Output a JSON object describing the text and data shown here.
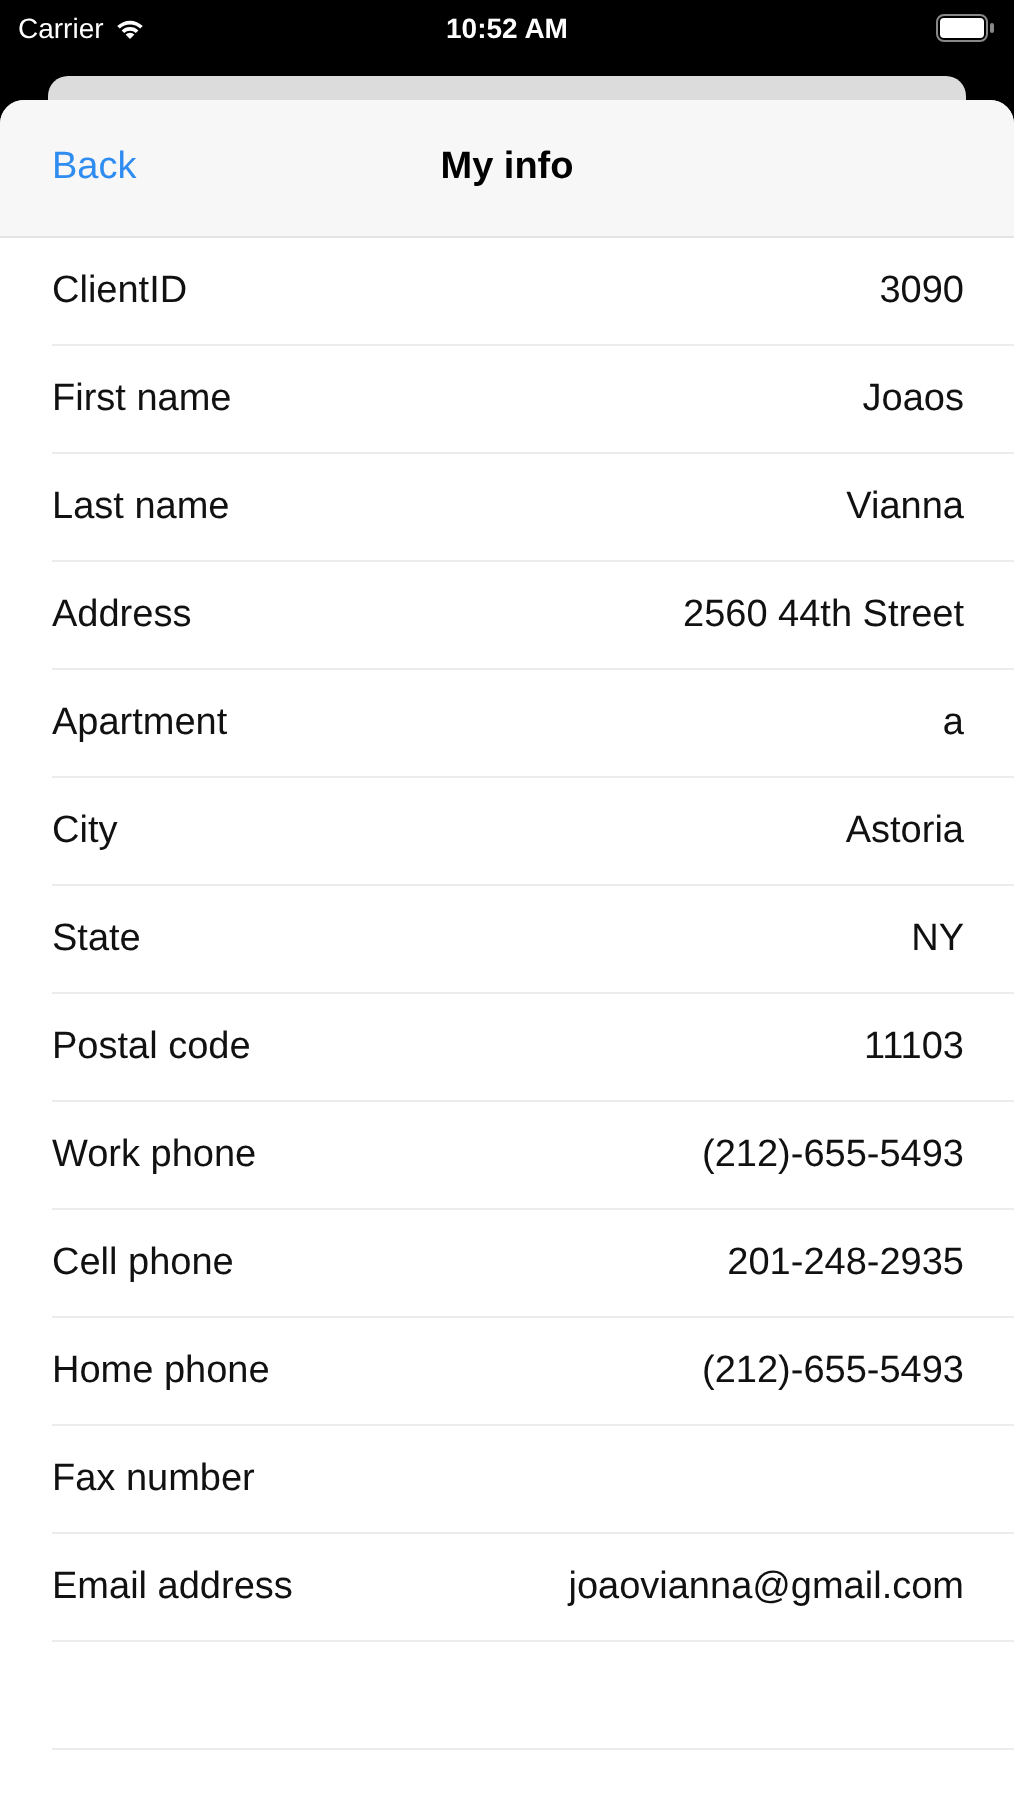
{
  "status_bar": {
    "carrier": "Carrier",
    "time": "10:52 AM"
  },
  "nav_bar": {
    "back": "Back",
    "title": "My info"
  },
  "fields": [
    {
      "label": "ClientID",
      "value": "3090"
    },
    {
      "label": "First name",
      "value": "Joaos"
    },
    {
      "label": "Last name",
      "value": "Vianna"
    },
    {
      "label": "Address",
      "value": "2560 44th Street"
    },
    {
      "label": "Apartment",
      "value": "a"
    },
    {
      "label": "City",
      "value": "Astoria"
    },
    {
      "label": "State",
      "value": "NY"
    },
    {
      "label": "Postal code",
      "value": "11103"
    },
    {
      "label": "Work phone",
      "value": "(212)-655-5493"
    },
    {
      "label": "Cell phone",
      "value": "201-248-2935"
    },
    {
      "label": "Home phone",
      "value": "(212)-655-5493"
    },
    {
      "label": "Fax number"
    },
    {
      "label": "Email address",
      "value": "joaovianna@gmail.com"
    }
  ]
}
